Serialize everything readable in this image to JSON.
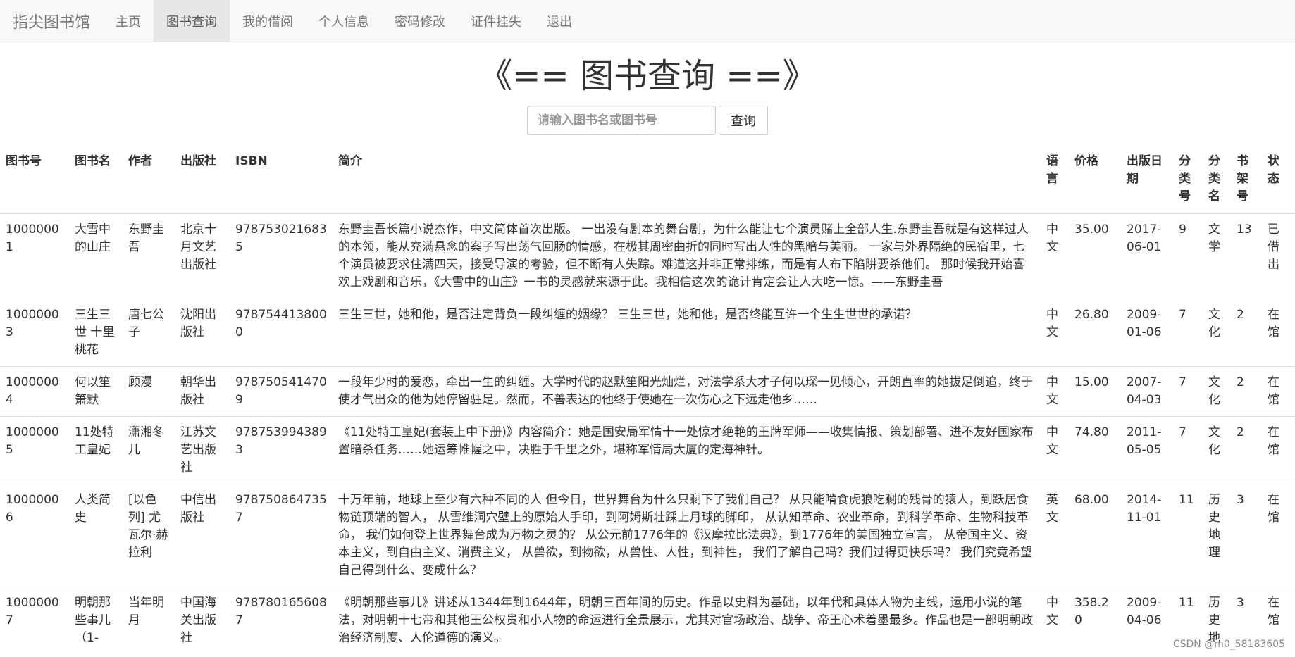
{
  "navbar": {
    "brand": "指尖图书馆",
    "items": [
      "主页",
      "图书查询",
      "我的借阅",
      "个人信息",
      "密码修改",
      "证件挂失",
      "退出"
    ]
  },
  "page": {
    "title": "《== 图书查询 ==》"
  },
  "search": {
    "placeholder": "请输入图书名或图书号",
    "button_label": "查询"
  },
  "table": {
    "headers": [
      "图书号",
      "图书名",
      "作者",
      "出版社",
      "ISBN",
      "简介",
      "语言",
      "价格",
      "出版日期",
      "分类号",
      "分类名",
      "书架号",
      "状态"
    ],
    "rows": [
      [
        "10000001",
        "大雪中的山庄",
        "东野圭吾",
        "北京十月文艺出版社",
        "9787530216835",
        "东野圭吾长篇小说杰作，中文简体首次出版。 一出没有剧本的舞台剧，为什么能让七个演员赌上全部人生.东野圭吾就是有这样过人的本领，能从充满悬念的案子写出荡气回肠的情感，在极其周密曲折的同时写出人性的黑暗与美丽。 一家与外界隔绝的民宿里，七个演员被要求住满四天，接受导演的考验，但不断有人失踪。难道这并非正常排练，而是有人布下陷阱要杀他们。 那时候我开始喜欢上戏剧和音乐，《大雪中的山庄》一书的灵感就来源于此。我相信这次的诡计肯定会让人大吃一惊。——东野圭吾",
        "中文",
        "35.00",
        "2017-06-01",
        "9",
        "文学",
        "13",
        "已借出"
      ],
      [
        "10000003",
        "三生三世 十里桃花",
        "唐七公子",
        "沈阳出版社",
        "9787544138000",
        "三生三世，她和他，是否注定背负一段纠缠的姻缘？ 三生三世，她和他，是否终能互许一个生生世世的承诺？",
        "中文",
        "26.80",
        "2009-01-06",
        "7",
        "文化",
        "2",
        "在馆"
      ],
      [
        "10000004",
        "何以笙箫默",
        "顾漫",
        "朝华出版社",
        "9787505414709",
        "一段年少时的爱恋，牵出一生的纠缠。大学时代的赵默笙阳光灿烂，对法学系大才子何以琛一见倾心，开朗直率的她拔足倒追，终于使才气出众的他为她停留驻足。然而，不善表达的他终于使她在一次伤心之下远走他乡……",
        "中文",
        "15.00",
        "2007-04-03",
        "7",
        "文化",
        "2",
        "在馆"
      ],
      [
        "10000005",
        "11处特工皇妃",
        "潇湘冬儿",
        "江苏文艺出版社",
        "9787539943893",
        "《11处特工皇妃(套装上中下册)》内容简介：她是国安局军情十一处惊才绝艳的王牌军师——收集情报、策划部署、进不友好国家布置暗杀任务……她运筹帷幄之中，决胜于千里之外，堪称军情局大厦的定海神针。",
        "中文",
        "74.80",
        "2011-05-05",
        "7",
        "文化",
        "2",
        "在馆"
      ],
      [
        "10000006",
        "人类简史",
        "[以色列] 尤瓦尔·赫拉利",
        "中信出版社",
        "9787508647357",
        "十万年前，地球上至少有六种不同的人 但今日，世界舞台为什么只剩下了我们自己？ 从只能啃食虎狼吃剩的残骨的猿人，到跃居食物链顶端的智人， 从雪维洞穴壁上的原始人手印，到阿姆斯壮踩上月球的脚印， 从认知革命、农业革命，到科学革命、生物科技革命， 我们如何登上世界舞台成为万物之灵的？ 从公元前1776年的《汉摩拉比法典》，到1776年的美国独立宣言， 从帝国主义、资本主义，到自由主义、消费主义， 从兽欲，到物欲，从兽性、人性，到神性， 我们了解自己吗？我们过得更快乐吗？ 我们究竟希望自己得到什么、变成什么？",
        "英文",
        "68.00",
        "2014-11-01",
        "11",
        "历史地理",
        "3",
        "在馆"
      ],
      [
        "10000007",
        "明朝那些事儿（1-",
        "当年明月",
        "中国海关出版社",
        "9787801656087",
        "《明朝那些事儿》讲述从1344年到1644年，明朝三百年间的历史。作品以史料为基础，以年代和具体人物为主线，运用小说的笔法，对明朝十七帝和其他王公权贵和小人物的命运进行全景展示，尤其对官场政治、战争、帝王心术着墨最多。作品也是一部明朝政治经济制度、人伦道德的演义。",
        "中文",
        "358.20",
        "2009-04-06",
        "11",
        "历史地",
        "3",
        "在馆"
      ]
    ]
  },
  "watermark": "CSDN @m0_58183605"
}
